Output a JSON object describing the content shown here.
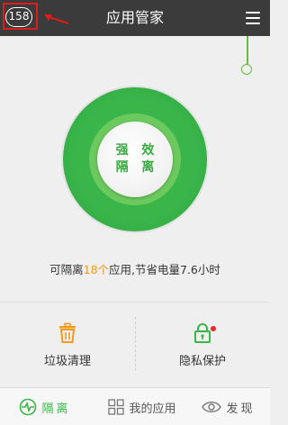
{
  "header": {
    "badge": "158",
    "title": "应用管家"
  },
  "main": {
    "button_line1": "强 效",
    "button_line2": "隔 离",
    "status": {
      "prefix": "可隔离",
      "count": "18个",
      "suffix": "应用,节省电量7.6小时"
    }
  },
  "tools": [
    {
      "label": "垃圾清理",
      "icon": "trash-icon"
    },
    {
      "label": "隐私保护",
      "icon": "lock-icon"
    }
  ],
  "bottom_nav": [
    {
      "label": "隔离",
      "icon": "pulse-icon",
      "active": true
    },
    {
      "label": "我的应用",
      "icon": "grid-icon",
      "active": false
    },
    {
      "label": "发现",
      "icon": "eye-icon",
      "active": false
    }
  ],
  "colors": {
    "header_bg": "#3b3b3b",
    "accent_green": "#39b54a",
    "highlight_orange": "#f19a1e",
    "annotation_red": "#e01b1b"
  }
}
